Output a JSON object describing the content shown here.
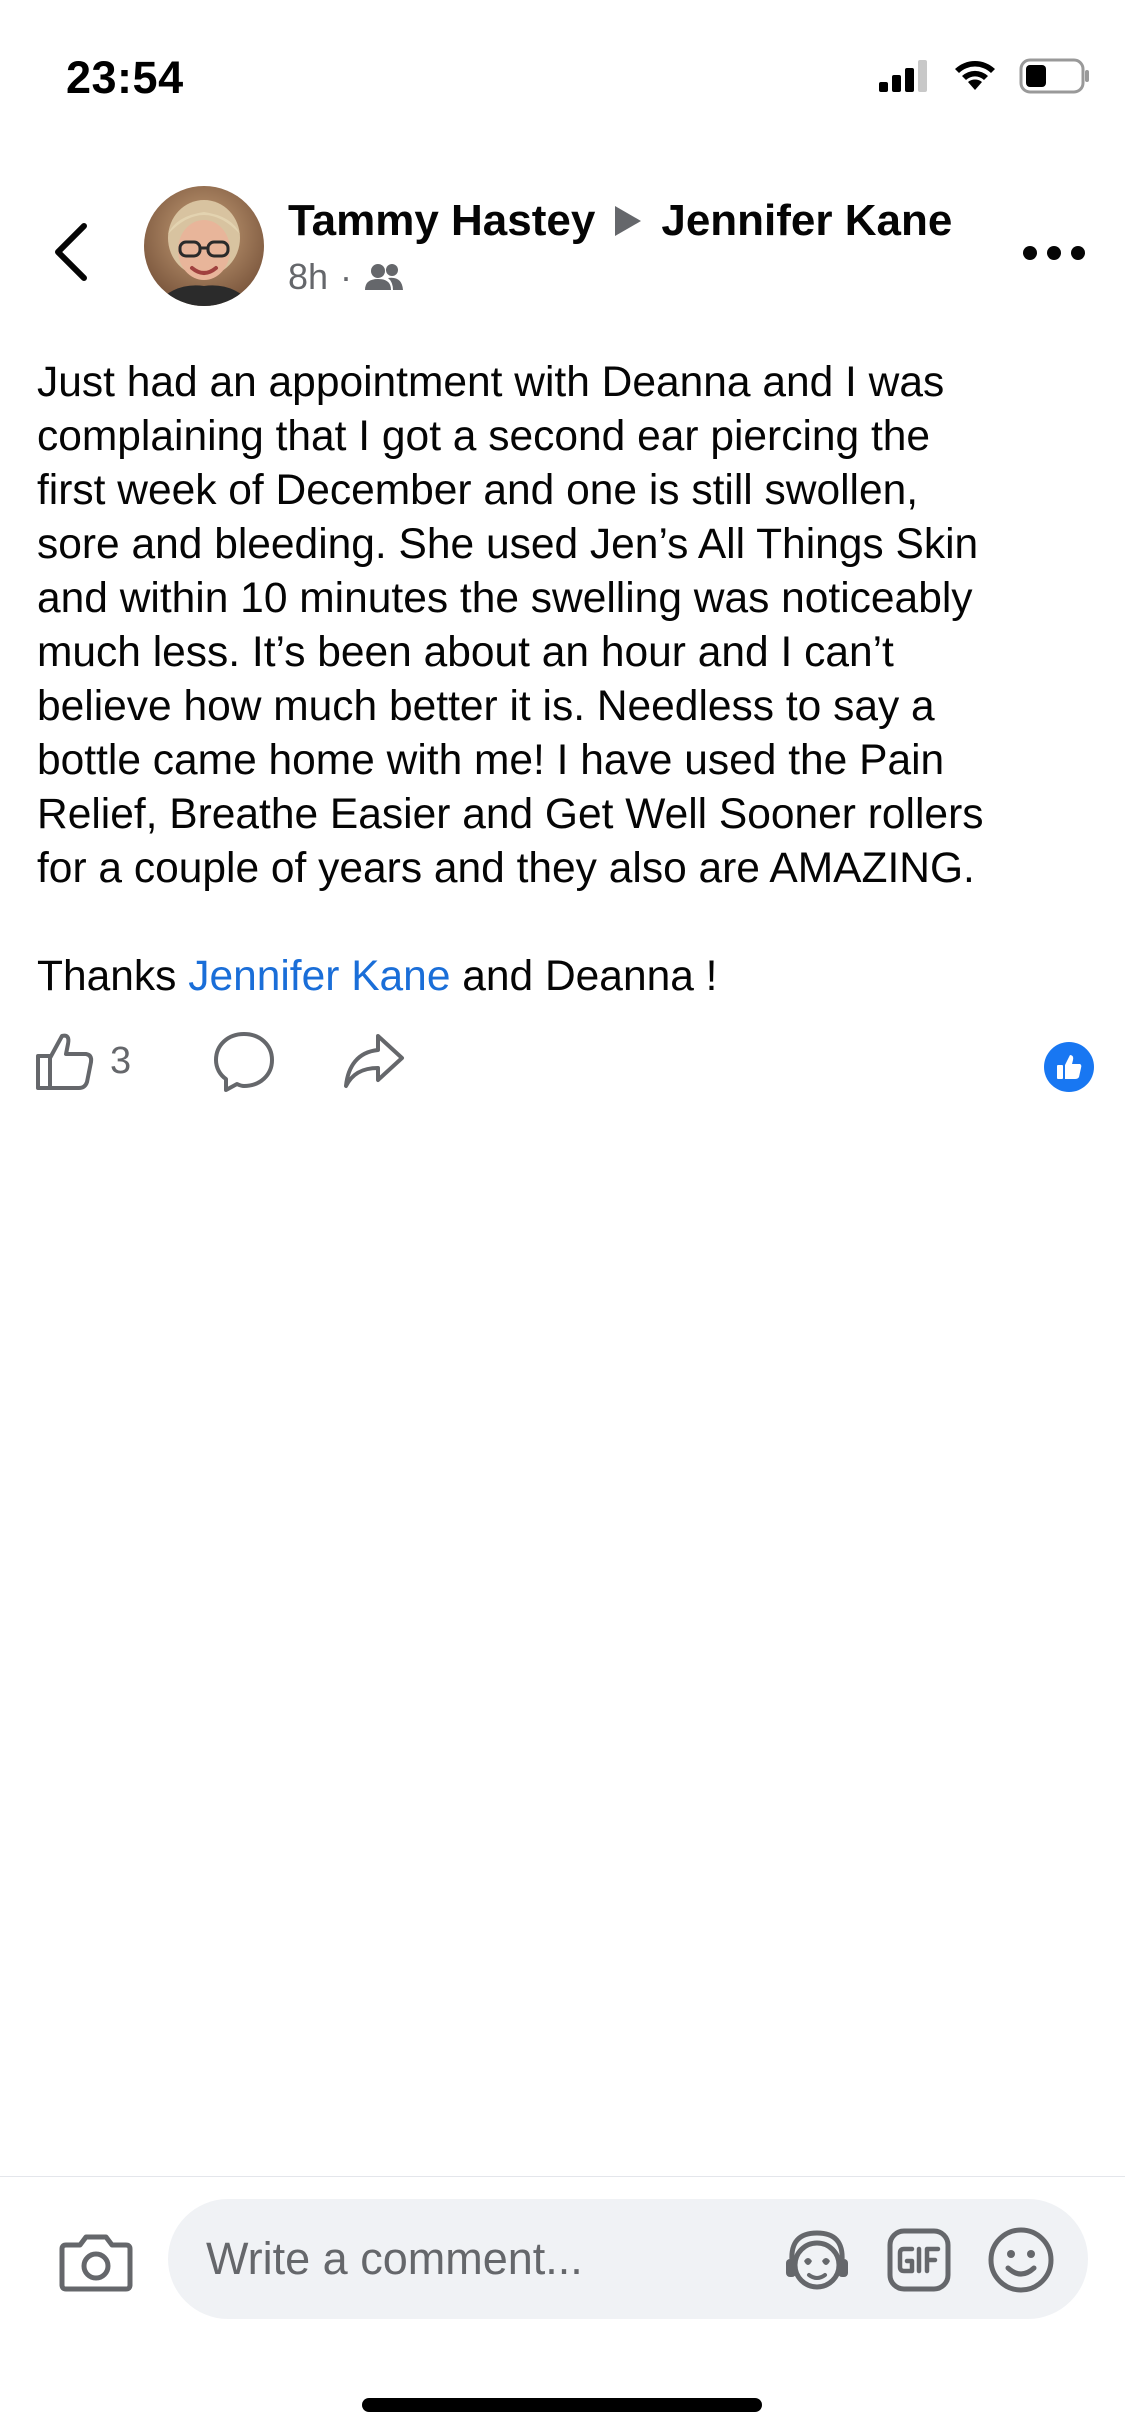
{
  "status_bar": {
    "time": "23:54",
    "icons": [
      "signal-icon",
      "wifi-icon",
      "battery-icon"
    ]
  },
  "post": {
    "author": "Tammy Hastey",
    "recipient": "Jennifer Kane",
    "time_ago": "8h",
    "separator": "·",
    "audience_icon": "friends-icon",
    "body_lines": [
      "Just had an appointment with Deanna and I was",
      "complaining that I got a second ear piercing the",
      "first week of December and one is still swollen,",
      "sore and bleeding. She used Jen’s  All Things Skin",
      "and within 10 minutes the swelling was noticeably",
      "much less. It’s been about an hour and I can’t",
      "believe how much better it is. Needless to say a",
      "bottle came home with me! I have used the Pain",
      "Relief, Breathe Easier and Get Well Sooner rollers",
      "for a couple of years and they also are AMAZING."
    ],
    "thanks_prefix": "Thanks ",
    "thanks_mention": "Jennifer Kane",
    "thanks_suffix": " and Deanna !"
  },
  "actions": {
    "like_count": "3",
    "icons": [
      "like-icon",
      "comment-icon",
      "share-icon",
      "like-reaction-badge"
    ]
  },
  "composer": {
    "placeholder": "Write a comment...",
    "icons": [
      "camera-icon",
      "avatar-sticker-icon",
      "gif-icon",
      "emoji-icon"
    ]
  },
  "colors": {
    "link": "#1a6ed8",
    "like_blue": "#1877f2",
    "secondary_text": "#65676b",
    "input_bg": "#f0f2f5"
  }
}
